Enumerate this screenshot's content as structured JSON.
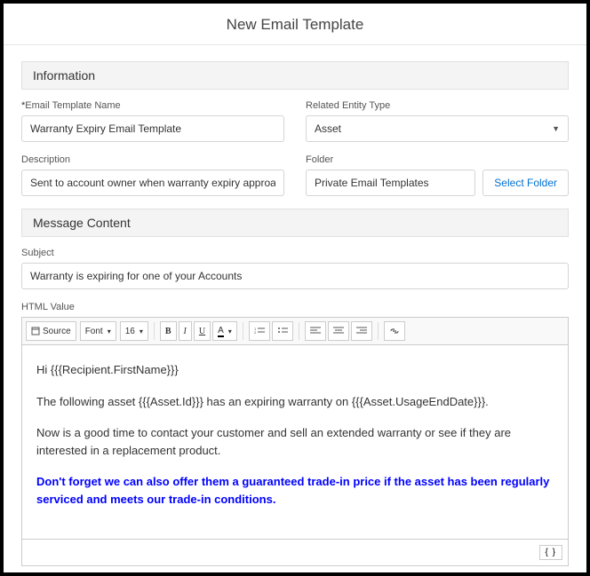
{
  "title": "New Email Template",
  "sections": {
    "info": "Information",
    "message": "Message Content"
  },
  "fields": {
    "name": {
      "label": "Email Template Name",
      "value": "Warranty Expiry Email Template"
    },
    "entity": {
      "label": "Related Entity Type",
      "value": "Asset"
    },
    "description": {
      "label": "Description",
      "value": "Sent to account owner when warranty expiry approaching"
    },
    "folder": {
      "label": "Folder",
      "value": "Private Email Templates",
      "button": "Select Folder"
    },
    "subject": {
      "label": "Subject",
      "value": "Warranty is expiring for one of your Accounts"
    },
    "html": {
      "label": "HTML Value"
    }
  },
  "toolbar": {
    "source": "Source",
    "font": "Font",
    "size": "16"
  },
  "editor": {
    "p1": "Hi {{{Recipient.FirstName}}}",
    "p2": "The following asset {{{Asset.Id}}} has an expiring warranty on {{{Asset.UsageEndDate}}}.",
    "p3": "Now is a good time to contact your customer and sell an extended warranty or see if they are interested in a replacement product.",
    "p4": "Don't forget we can also offer them a guaranteed trade-in price if the asset has been regularly serviced and meets our trade-in conditions."
  },
  "footer": {
    "braces": "{ }"
  }
}
